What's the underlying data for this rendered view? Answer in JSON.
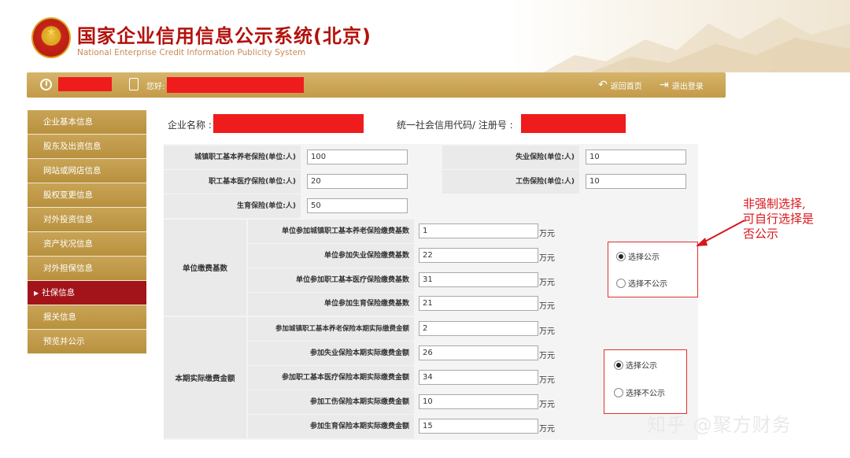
{
  "header": {
    "title": "国家企业信用信息公示系统(北京)",
    "subtitle": "National Enterprise Credit Information Publicity System"
  },
  "userbar": {
    "greeting": "您好:",
    "home_label": "返回首页",
    "logout_label": "退出登录"
  },
  "sidebar": {
    "items": [
      {
        "label": "企业基本信息"
      },
      {
        "label": "股东及出资信息"
      },
      {
        "label": "网站或网店信息"
      },
      {
        "label": "股权变更信息"
      },
      {
        "label": "对外投资信息"
      },
      {
        "label": "资产状况信息"
      },
      {
        "label": "对外担保信息"
      },
      {
        "label": "社保信息"
      },
      {
        "label": "报关信息"
      },
      {
        "label": "预览并公示"
      }
    ],
    "active_index": 7
  },
  "company": {
    "name_label": "企业名称 :",
    "credit_label": "统一社会信用代码/ 注册号 :"
  },
  "insured": {
    "urban_pension_label": "城镇职工基本养老保险(单位:人)",
    "urban_pension_value": "100",
    "unemployment_label": "失业保险(单位:人)",
    "unemployment_value": "10",
    "medical_label": "职工基本医疗保险(单位:人)",
    "medical_value": "20",
    "injury_label": "工伤保险(单位:人)",
    "injury_value": "10",
    "maternity_label": "生育保险(单位:人)",
    "maternity_value": "50"
  },
  "base": {
    "group_label": "单位缴费基数",
    "unit": "万元",
    "rows": [
      {
        "label": "单位参加城镇职工基本养老保险缴费基数",
        "value": "1"
      },
      {
        "label": "单位参加失业保险缴费基数",
        "value": "22"
      },
      {
        "label": "单位参加职工基本医疗保险缴费基数",
        "value": "31"
      },
      {
        "label": "单位参加生育保险缴费基数",
        "value": "21"
      }
    ]
  },
  "actual": {
    "group_label": "本期实际缴费金额",
    "unit": "万元",
    "rows": [
      {
        "label": "参加城镇职工基本养老保险本期实际缴费金额",
        "value": "2"
      },
      {
        "label": "参加失业保险本期实际缴费金额",
        "value": "26"
      },
      {
        "label": "参加职工基本医疗保险本期实际缴费金额",
        "value": "34"
      },
      {
        "label": "参加工伤保险本期实际缴费金额",
        "value": "10"
      },
      {
        "label": "参加生育保险本期实际缴费金额",
        "value": "15"
      }
    ]
  },
  "radio_base": {
    "publish_label": "选择公示",
    "not_publish_label": "选择不公示",
    "selected": "publish"
  },
  "radio_actual": {
    "publish_label": "选择公示",
    "not_publish_label": "选择不公示",
    "selected": "publish"
  },
  "annotation": {
    "line1": "非强制选择,",
    "line2": "可自行选择是",
    "line3": "否公示"
  },
  "watermark": "知乎 @聚方财务",
  "colors": {
    "brand_red": "#b3120d",
    "gold": "#c39a48",
    "active_red": "#a3141a",
    "annotation_red": "#d8161b"
  }
}
